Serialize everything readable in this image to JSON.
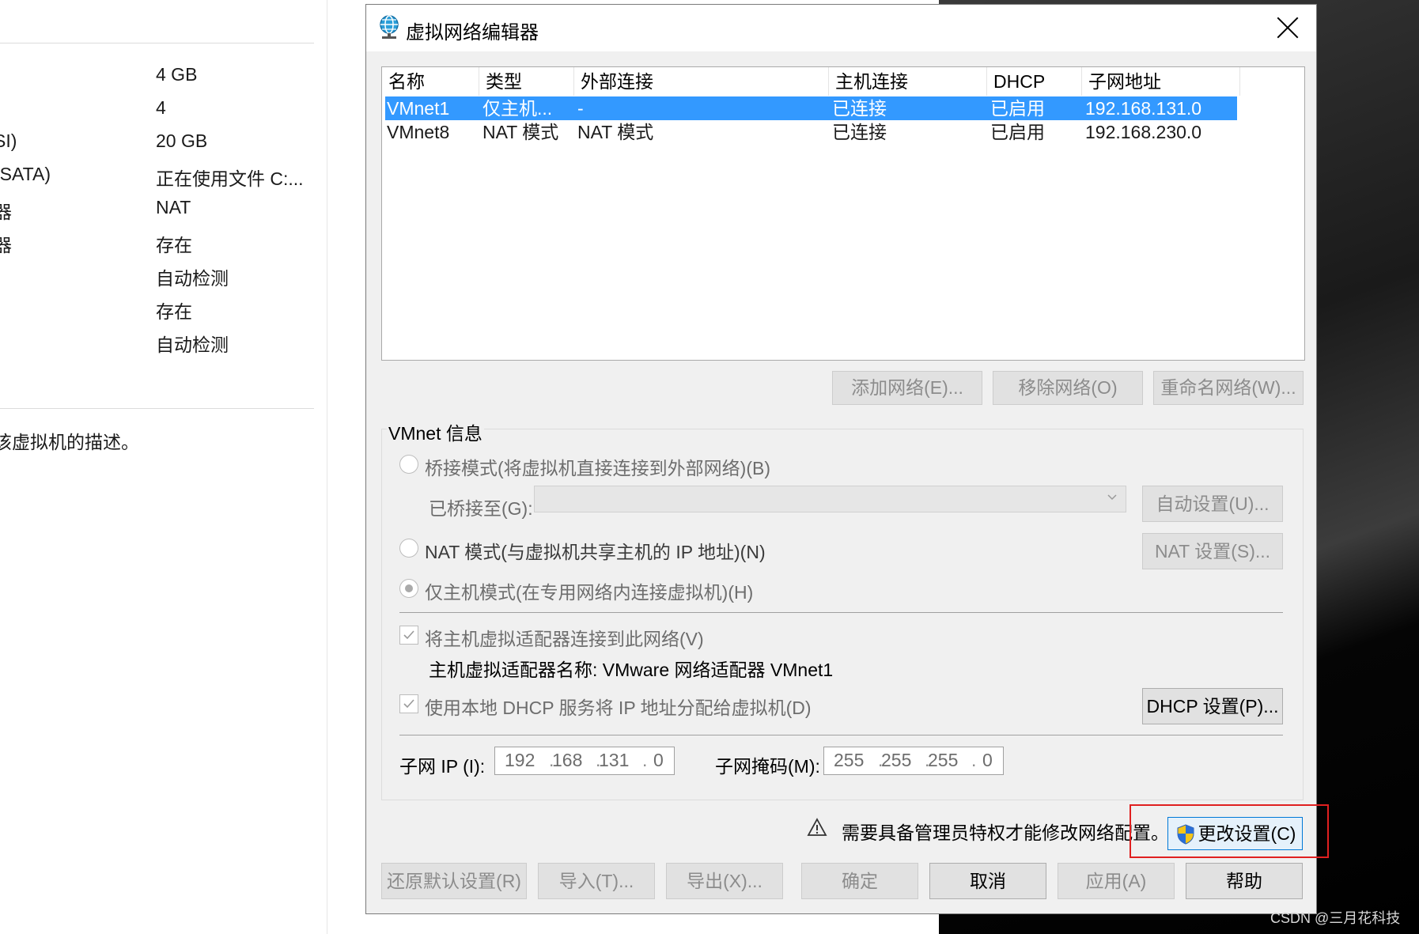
{
  "left_panel": {
    "specs": [
      {
        "key": "",
        "value": "4 GB"
      },
      {
        "key": "",
        "value": "4"
      },
      {
        "key": "SI)",
        "value": "20 GB"
      },
      {
        "key": "(SATA)",
        "value": "正在使用文件 C:..."
      },
      {
        "key": "器",
        "value": "NAT"
      },
      {
        "key": "器",
        "value": "存在"
      },
      {
        "key": "",
        "value": "自动检测"
      },
      {
        "key": "",
        "value": "存在"
      },
      {
        "key": "",
        "value": "自动检测"
      }
    ],
    "description": "该虚拟机的描述。"
  },
  "dialog": {
    "title": "虚拟网络编辑器",
    "table": {
      "headers": [
        "名称",
        "类型",
        "外部连接",
        "主机连接",
        "DHCP",
        "子网地址"
      ],
      "rows": [
        {
          "name": "VMnet1",
          "type": "仅主机...",
          "external": "-",
          "host": "已连接",
          "dhcp": "已启用",
          "subnet": "192.168.131.0",
          "selected": true
        },
        {
          "name": "VMnet8",
          "type": "NAT 模式",
          "external": "NAT 模式",
          "host": "已连接",
          "dhcp": "已启用",
          "subnet": "192.168.230.0",
          "selected": false
        }
      ]
    },
    "buttons": {
      "add_network": "添加网络(E)...",
      "remove_network": "移除网络(O)",
      "rename_network": "重命名网络(W)..."
    },
    "vmnet_info": {
      "label": "VMnet 信息",
      "bridge_mode": "桥接模式(将虚拟机直接连接到外部网络)(B)",
      "bridged_to_label": "已桥接至(G):",
      "auto_settings": "自动设置(U)...",
      "nat_mode": "NAT 模式(与虚拟机共享主机的 IP 地址)(N)",
      "nat_settings": "NAT 设置(S)...",
      "host_only_mode": "仅主机模式(在专用网络内连接虚拟机)(H)",
      "connect_adapter": "将主机虚拟适配器连接到此网络(V)",
      "adapter_name": "主机虚拟适配器名称: VMware 网络适配器 VMnet1",
      "use_dhcp": "使用本地 DHCP 服务将 IP 地址分配给虚拟机(D)",
      "dhcp_settings": "DHCP 设置(P)...",
      "subnet_ip_label": "子网 IP (I):",
      "subnet_ip": [
        "192",
        "168",
        "131",
        "0"
      ],
      "subnet_mask_label": "子网掩码(M):",
      "subnet_mask": [
        "255",
        "255",
        "255",
        "0"
      ]
    },
    "admin_warning": "需要具备管理员特权才能修改网络配置。",
    "change_settings": "更改设置(C)",
    "footer": {
      "restore_defaults": "还原默认设置(R)",
      "import": "导入(T)...",
      "export": "导出(X)...",
      "ok": "确定",
      "cancel": "取消",
      "apply": "应用(A)",
      "help": "帮助"
    }
  },
  "watermark": "CSDN @三月花科技",
  "colors": {
    "selection": "#3399ff",
    "highlight_box": "#e02020",
    "dialog_bg": "#f0f0f0"
  }
}
